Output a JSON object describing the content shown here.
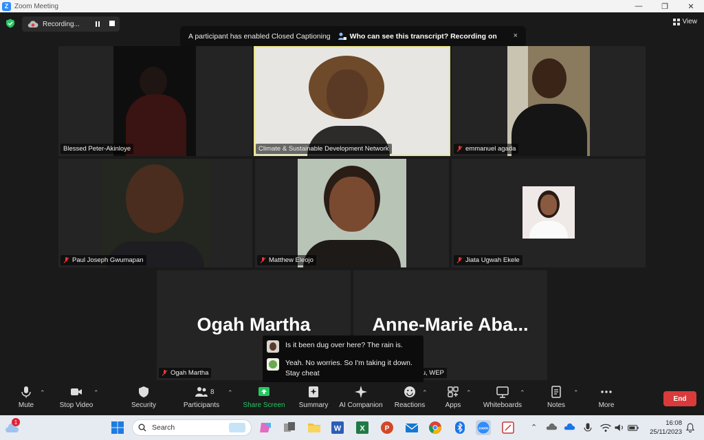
{
  "window": {
    "title": "Zoom Meeting",
    "minimize": "—",
    "maximize": "❐",
    "close": "✕"
  },
  "recording": {
    "label": "Recording..."
  },
  "caption_banner": {
    "text": "A participant has enabled Closed Captioning",
    "who": "Who can see this transcript? Recording on",
    "close": "×"
  },
  "view": {
    "label": "View"
  },
  "participants": [
    {
      "name": "Blessed Peter-Akinloye",
      "muted": false
    },
    {
      "name": "Climate & Sustainable Development Network",
      "muted": false,
      "active": true
    },
    {
      "name": "emmanuel agada",
      "muted": true
    },
    {
      "name": "Paul Joseph Gwumapan",
      "muted": true
    },
    {
      "name": "Matthew Eleojo",
      "muted": true
    },
    {
      "name": "Jiata Ugwah Ekele",
      "muted": true
    },
    {
      "name": "Ogah Martha",
      "muted": true,
      "display": "Ogah Martha"
    },
    {
      "name": "Anne-Marie Abaagu, WEP",
      "muted": true,
      "display": "Anne-Marie  Aba..."
    }
  ],
  "captions": [
    {
      "text": "Is it been dug over here? The rain is."
    },
    {
      "text": "Yeah. No worries. So I'm taking it down. Stay cheat"
    }
  ],
  "toolbar": {
    "mute": "Mute",
    "stop_video": "Stop Video",
    "security": "Security",
    "participants": "Participants",
    "participant_count": "8",
    "share_screen": "Share Screen",
    "summary": "Summary",
    "ai_companion": "AI Companion",
    "reactions": "Reactions",
    "apps": "Apps",
    "whiteboards": "Whiteboards",
    "notes": "Notes",
    "more": "More",
    "end": "End"
  },
  "taskbar": {
    "search_label": "Search",
    "weather_badge": "1",
    "time": "16:08",
    "date": "25/11/2023"
  },
  "colors": {
    "active_border": "#e9e48a",
    "share_green": "#27c763",
    "end_red": "#d93b3b",
    "zoom_blue": "#2d8cff"
  }
}
